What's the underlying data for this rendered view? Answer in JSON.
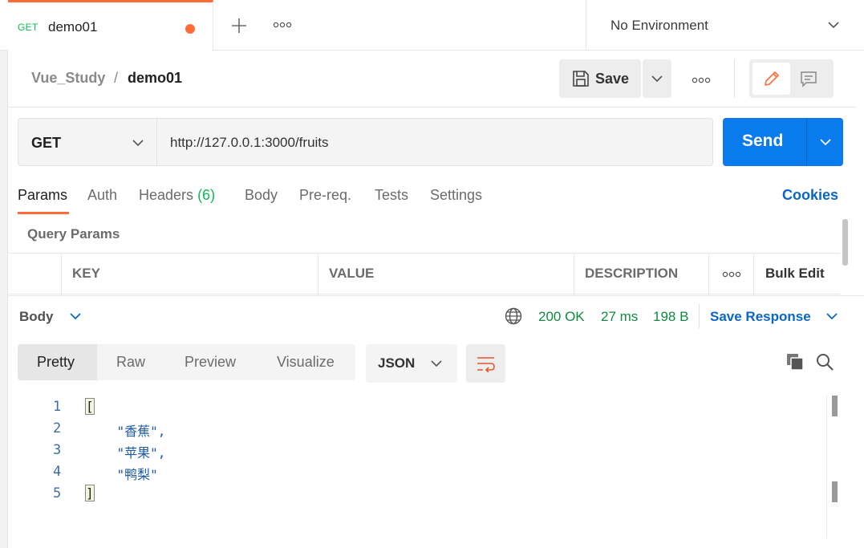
{
  "tab": {
    "method": "GET",
    "name": "demo01"
  },
  "environment": {
    "label": "No Environment"
  },
  "breadcrumb": {
    "parent": "Vue_Study",
    "separator": "/",
    "current": "demo01"
  },
  "toolbar": {
    "save_label": "Save"
  },
  "request": {
    "method": "GET",
    "url": "http://127.0.0.1:3000/fruits",
    "send_label": "Send"
  },
  "request_tabs": [
    {
      "label": "Params"
    },
    {
      "label": "Auth"
    },
    {
      "label": "Headers",
      "count": "(6)"
    },
    {
      "label": "Body"
    },
    {
      "label": "Pre-req."
    },
    {
      "label": "Tests"
    },
    {
      "label": "Settings"
    }
  ],
  "cookies_label": "Cookies",
  "query_params": {
    "title": "Query Params",
    "columns": [
      "KEY",
      "VALUE",
      "DESCRIPTION"
    ],
    "bulk_edit_label": "Bulk Edit"
  },
  "response": {
    "body_label": "Body",
    "status": "200 OK",
    "time": "27 ms",
    "size": "198 B",
    "save_response_label": "Save Response",
    "views": [
      "Pretty",
      "Raw",
      "Preview",
      "Visualize"
    ],
    "format": "JSON",
    "line_numbers": [
      "1",
      "2",
      "3",
      "4",
      "5"
    ],
    "lines": [
      "[",
      "    \"香蕉\",",
      "    \"苹果\",",
      "    \"鸭梨\"",
      "]"
    ]
  },
  "colors": {
    "accent": "#ff6c37",
    "primary": "#097bed",
    "success": "#0cbb52",
    "link": "#0a66c6"
  }
}
